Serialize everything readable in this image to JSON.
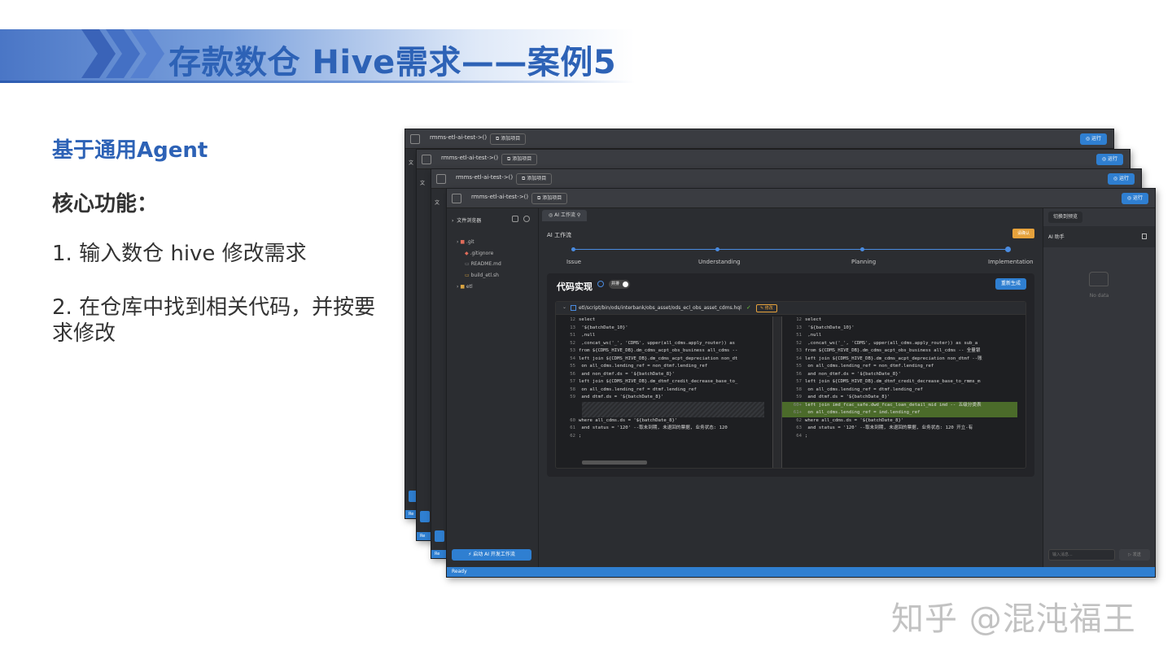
{
  "header": {
    "title": "存款数仓 Hive需求——案例5"
  },
  "left": {
    "subtitle": "基于通用Agent",
    "core_title": "核心功能：",
    "items": [
      "1. 输入数仓 hive 修改需求",
      "2. 在仓库中找到相关代码，并按要求修改"
    ]
  },
  "app": {
    "window_title": "rmms-etl-ai-test->()",
    "add_project": "添加项目",
    "run": "运行",
    "back_sidebar_stub": "文",
    "back_ready_stub": "Re",
    "file_browser": "文件浏览器",
    "tree": [
      ".git",
      ".gitignore",
      "README.md",
      "build_etl.sh",
      "etl"
    ],
    "start_button": "启动 AI 开发工作流",
    "tab": "AI 工作流",
    "workflow_label": "AI 工作流",
    "confirm_button": "请确认",
    "steps": [
      "Issue",
      "Understanding",
      "Planning",
      "Implementation"
    ],
    "code_title": "代码实现",
    "toggle_label": "并排",
    "regen_button": "重新生成",
    "file_path": "etl/script/bin/ods/interbank/obs_asset/ods_ecl_obs_asset_cdms.hql",
    "modified_badge": "修改",
    "left_code": [
      [
        "12",
        "select"
      ],
      [
        "13",
        "    '${batchDate_10}'"
      ],
      [
        "51",
        "    ,null"
      ],
      [
        "52",
        "    ,concat_ws('_', 'CDMS', upper(all_cdms.apply_router)) as"
      ],
      [
        "53",
        "from ${CDMS_HIVE_DB}.dm_cdms_acpt_obs_business all_cdms --"
      ],
      [
        "54",
        "left join ${CDMS_HIVE_DB}.dm_cdms_acpt_depreciation non_dt"
      ],
      [
        "55",
        "    on all_cdms.lending_ref = non_dtmf.lending_ref"
      ],
      [
        "56",
        "    and non_dtmf.ds = '${batchDate_8}'"
      ],
      [
        "57",
        "left join ${CDMS_HIVE_DB}.dm_dtmf_credit_decrease_base_to_"
      ],
      [
        "58",
        "    on all_cdms.lending_ref = dtmf.lending_ref"
      ],
      [
        "59",
        "    and dtmf.ds = '${batchDate_8}'"
      ],
      [
        "60",
        "where all_cdms.ds = '${batchDate_8}'"
      ],
      [
        "61",
        "    and status = '120'   --取未到期, 未退回的票据,  业务状态:  120"
      ],
      [
        "62",
        ";"
      ]
    ],
    "right_code": [
      [
        "12",
        "select"
      ],
      [
        "13",
        "    '${batchDate_10}'"
      ],
      [
        "51",
        "    ,null"
      ],
      [
        "52",
        "    ,concat_ws('_', 'CDMS', upper(all_cdms.apply_router)) as sub_a"
      ],
      [
        "53",
        "from ${CDMS_HIVE_DB}.dm_cdms_acpt_obs_business all_cdms -- 全量银"
      ],
      [
        "54",
        "left join ${CDMS_HIVE_DB}.dm_cdms_acpt_depreciation non_dtmf --账"
      ],
      [
        "55",
        "    on all_cdms.lending_ref = non_dtmf.lending_ref"
      ],
      [
        "56",
        "    and non_dtmf.ds = '${batchDate_8}'"
      ],
      [
        "57",
        "left join ${CDMS_HIVE_DB}.dm_dtmf_credit_decrease_base_to_rmms_m"
      ],
      [
        "58",
        "    on all_cdms.lending_ref = dtmf.lending_ref"
      ],
      [
        "59",
        "    and dtmf.ds = '${batchDate_8}'"
      ],
      [
        "60+",
        "left join imd_fcac_safe.dwd_fcac_loan_detail_mid imd  -- 五级分类表"
      ],
      [
        "61+",
        "    on all_cdms.lending_ref = imd.lending_ref"
      ],
      [
        "62",
        "where all_cdms.ds = '${batchDate_8}'"
      ],
      [
        "63",
        "    and status = '120'   --取未到期, 未退回的票据,  业务状态:  120 开立-有"
      ],
      [
        "64",
        ";"
      ]
    ],
    "switch_preview": "切换到预览",
    "ai_assistant": "AI 助手",
    "no_data": "No data",
    "input_placeholder": "输入消息...",
    "send": "发送",
    "status": "Ready"
  },
  "watermark": "知乎 @混沌福王",
  "colors": {
    "accent_blue": "#2d62b6",
    "app_blue": "#2f7fd1",
    "highlight_green": "#4b6b2a",
    "warning_orange": "#e6a23c"
  }
}
